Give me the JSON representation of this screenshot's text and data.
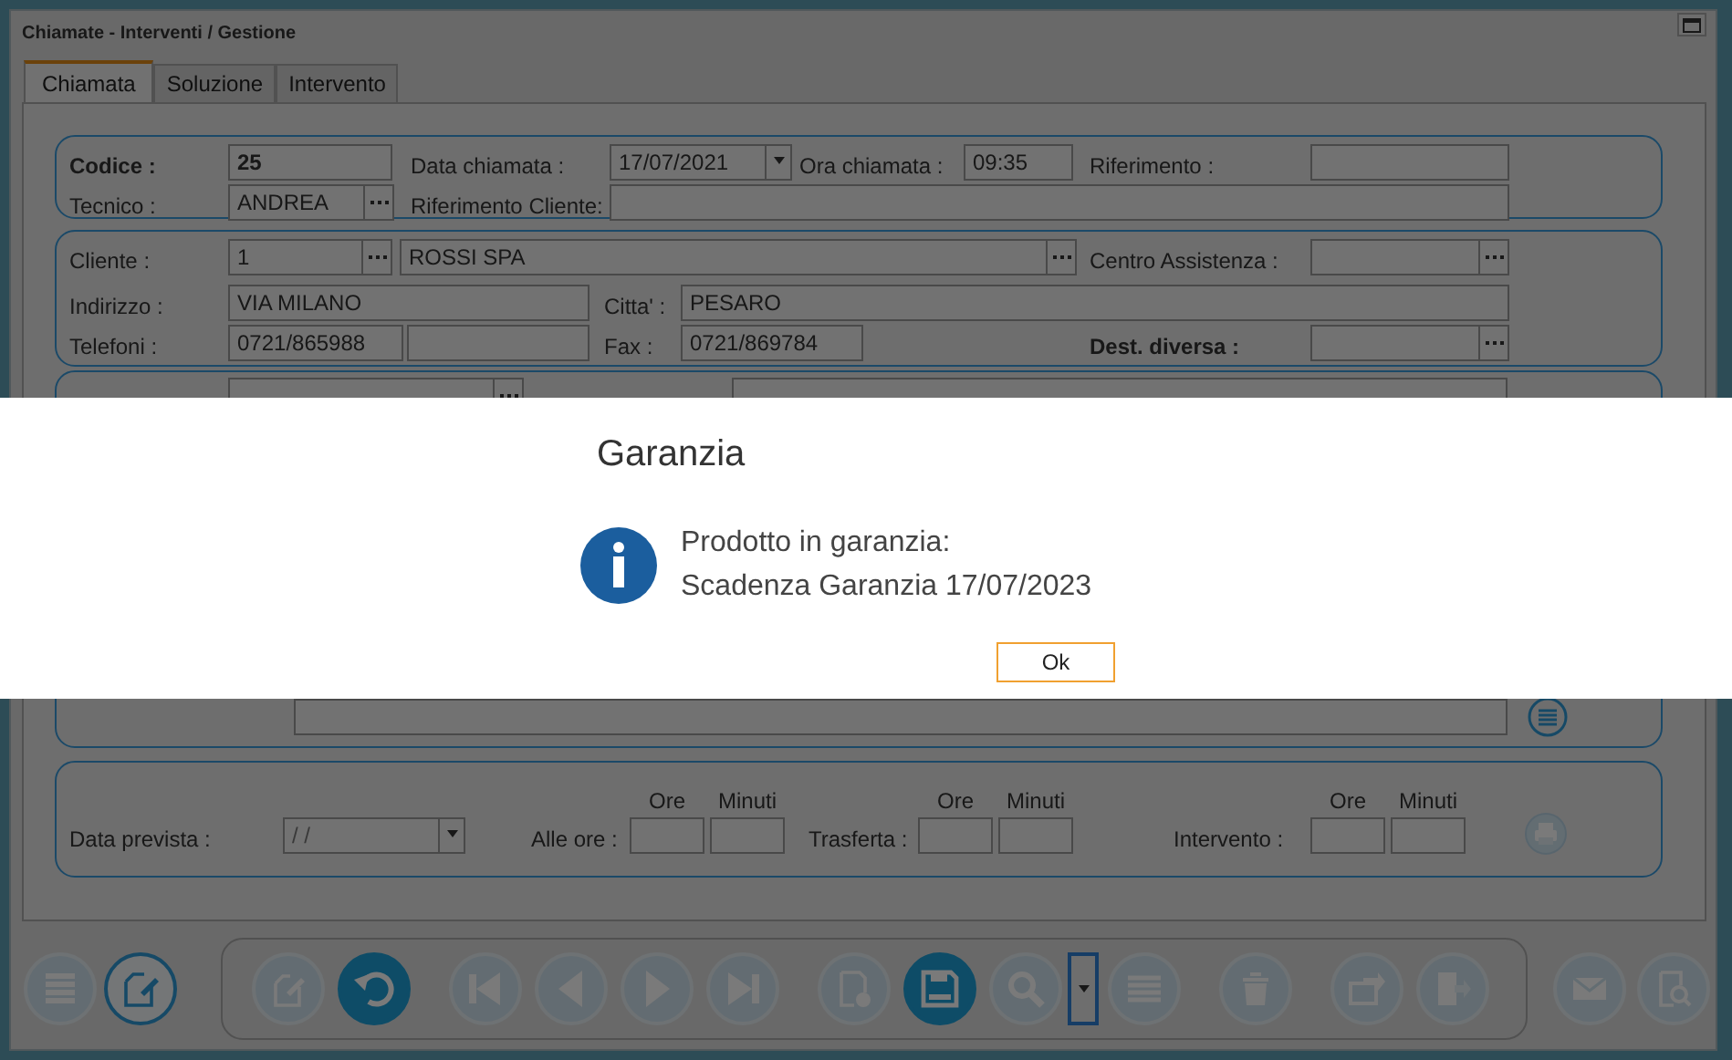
{
  "window": {
    "title": "Chiamate - Interventi / Gestione"
  },
  "tabs": [
    {
      "label": "Chiamata",
      "selected": true
    },
    {
      "label": "Soluzione",
      "selected": false
    },
    {
      "label": "Intervento",
      "selected": false
    }
  ],
  "groups": [
    {
      "rows": [
        [
          {
            "kind": "label",
            "text": "Codice :",
            "bold": true
          },
          {
            "kind": "field",
            "value": "25",
            "bold": true
          },
          {
            "kind": "label",
            "text": "Data chiamata :",
            "bold": false
          },
          {
            "kind": "date",
            "value": "17/07/2021",
            "bold": false
          },
          {
            "kind": "label",
            "text": "Ora chiamata :",
            "bold": false
          },
          {
            "kind": "field",
            "value": "09:35",
            "bold": false
          },
          {
            "kind": "label",
            "text": "Riferimento :",
            "bold": false
          },
          {
            "kind": "field"
          }
        ],
        [
          {
            "kind": "label",
            "text": "Tecnico :",
            "bold": false
          },
          {
            "kind": "lookup",
            "value": "ANDREA",
            "bold": false
          },
          {
            "kind": "label",
            "text": "Riferimento Cliente:",
            "bold": false
          },
          {
            "kind": "field"
          }
        ]
      ]
    },
    {
      "rows": [
        [
          {
            "kind": "label",
            "text": "Cliente :",
            "bold": false
          },
          {
            "kind": "lookup",
            "value": "1",
            "bold": false
          },
          {
            "kind": "lookup",
            "value": "ROSSI SPA",
            "bold": false
          },
          "",
          "",
          {
            "kind": "label",
            "text": "Centro Assistenza :",
            "bold": false
          },
          {
            "kind": "lookup"
          }
        ],
        [
          {
            "kind": "label",
            "text": "Indirizzo :",
            "bold": false
          },
          {
            "kind": "field",
            "value": "VIA MILANO",
            "bold": false
          },
          "",
          {
            "kind": "label",
            "text": "Citta' :",
            "bold": false
          },
          {
            "kind": "field",
            "value": "PESARO",
            "bold": false
          }
        ],
        [
          {
            "kind": "label",
            "text": "Telefoni :",
            "bold": false
          },
          {
            "kind": "field",
            "value": "0721/865988",
            "bold": false
          },
          {
            "kind": "field"
          },
          {
            "kind": "label",
            "text": "Fax :",
            "bold": false
          },
          {
            "kind": "field",
            "value": "0721/869784",
            "bold": false
          },
          {
            "kind": "label",
            "text": "Dest. diversa :",
            "bold": true
          },
          {
            "kind": "lookup"
          }
        ]
      ]
    }
  ],
  "schedule": {
    "date_label": "Data prevista :",
    "date_value": "/ /",
    "entries": [
      {
        "label": "Alle ore :",
        "headers": [
          "Ore",
          "Minuti"
        ]
      },
      {
        "label": "Trasferta :",
        "headers": [
          "Ore",
          "Minuti"
        ]
      },
      {
        "label": "Intervento :",
        "headers": [
          "Ore",
          "Minuti"
        ]
      }
    ]
  },
  "toolbar": {
    "left": [
      {
        "kind": "faded"
      },
      {
        "kind": "outlined"
      }
    ],
    "main": [
      [
        {
          "kind": "faded"
        },
        {
          "kind": "filled"
        }
      ],
      [
        {
          "kind": "faded"
        },
        {
          "kind": "faded"
        },
        {
          "kind": "faded"
        },
        {
          "kind": "faded"
        }
      ],
      [
        {
          "kind": "faded"
        },
        {
          "kind": "filled"
        },
        {
          "kind": "faded"
        },
        {
          "kind": "dropdown"
        },
        {
          "kind": "faded"
        }
      ],
      [
        {
          "kind": "faded"
        }
      ],
      [
        {
          "kind": "faded"
        },
        {
          "kind": "faded"
        }
      ]
    ],
    "right": [
      {
        "kind": "faded"
      },
      {
        "kind": "faded"
      }
    ]
  },
  "dialog": {
    "title": "Garanzia",
    "message": [
      "Prodotto in garanzia:",
      "Scadenza Garanzia 17/07/2023"
    ],
    "buttons": [
      {
        "label": "Ok",
        "default": true
      }
    ]
  }
}
